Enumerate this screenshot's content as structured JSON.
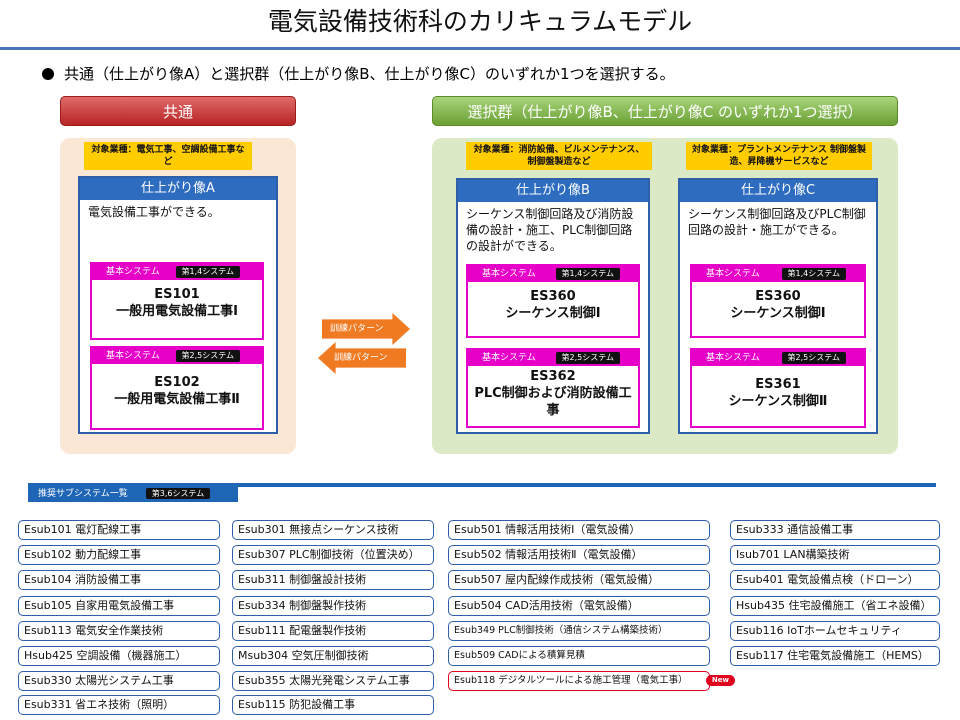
{
  "title": "電気設備技術科のカリキュラムモデル",
  "intro": "共通（仕上がり像A）と選択群（仕上がり像B、仕上がり像C）のいずれか1つを選択する。",
  "common": {
    "band": "共通",
    "target": "対象業種：電気工事、空調設備工事など",
    "image": {
      "title": "仕上がり像A",
      "desc": "電気設備工事ができる。",
      "systems": [
        {
          "head": "基本システム",
          "tag": "第1,4システム",
          "code": "ES101",
          "name": "一般用電気設備工事Ⅰ"
        },
        {
          "head": "基本システム",
          "tag": "第2,5システム",
          "code": "ES102",
          "name": "一般用電気設備工事Ⅱ"
        }
      ]
    }
  },
  "select": {
    "band": "選択群（仕上がり像B、仕上がり像C のいずれか1つ選択）",
    "targets": [
      "対象業種：消防設備、ビルメンテナンス、制御盤製造など",
      "対象業種：プラントメンテナンス 制御盤製造、昇降機サービスなど"
    ],
    "images": [
      {
        "title": "仕上がり像B",
        "desc": "シーケンス制御回路及び消防設備の設計・施工、PLC制御回路の設計ができる。",
        "systems": [
          {
            "head": "基本システム",
            "tag": "第1,4システム",
            "code": "ES360",
            "name": "シーケンス制御Ⅰ"
          },
          {
            "head": "基本システム",
            "tag": "第2,5システム",
            "code": "ES362",
            "name": "PLC制御および消防設備工事"
          }
        ]
      },
      {
        "title": "仕上がり像C",
        "desc": "シーケンス制御回路及びPLC制御回路の設計・施工ができる。",
        "systems": [
          {
            "head": "基本システム",
            "tag": "第1,4システム",
            "code": "ES360",
            "name": "シーケンス制御Ⅰ"
          },
          {
            "head": "基本システム",
            "tag": "第2,5システム",
            "code": "ES361",
            "name": "シーケンス制御Ⅱ"
          }
        ]
      }
    ]
  },
  "arrows": {
    "right": "訓練パターン",
    "left": "訓練パターン"
  },
  "subsystems": {
    "label": "推奨サブシステム一覧",
    "tag": "第3,6システム",
    "col1": [
      "Esub101 電灯配線工事",
      "Esub102 動力配線工事",
      "Esub104 消防設備工事",
      "Esub105 自家用電気設備工事",
      "Esub113 電気安全作業技術",
      "Hsub425 空調設備（機器施工）",
      "Esub330 太陽光システム工事",
      "Esub331 省エネ技術（照明）"
    ],
    "col2": [
      "Esub301 無接点シーケンス技術",
      "Esub307 PLC制御技術（位置決め）",
      "Esub311 制御盤設計技術",
      "Esub334 制御盤製作技術",
      "Esub111 配電盤製作技術",
      "Msub304 空気圧制御技術",
      "Esub355 太陽光発電システム工事",
      "Esub115 防犯設備工事"
    ],
    "col3": [
      "Esub501 情報活用技術Ⅰ（電気設備）",
      "Esub502 情報活用技術Ⅱ（電気設備）",
      "Esub507 屋内配線作成技術（電気設備）",
      "Esub504 CAD活用技術（電気設備）",
      "Esub349 PLC制御技術（通信システム構築技術）",
      "Esub509 CADによる積算見積",
      "Esub118 デジタルツールによる施工管理（電気工事）"
    ],
    "col4": [
      "Esub333 通信設備工事",
      "Isub701 LAN構築技術",
      "Esub401 電気設備点検（ドローン）",
      "Hsub435 住宅設備施工（省エネ設備）",
      "Esub116 IoTホームセキュリティ",
      "Esub117 住宅電気設備施工（HEMS）"
    ],
    "new_badge": "New"
  }
}
